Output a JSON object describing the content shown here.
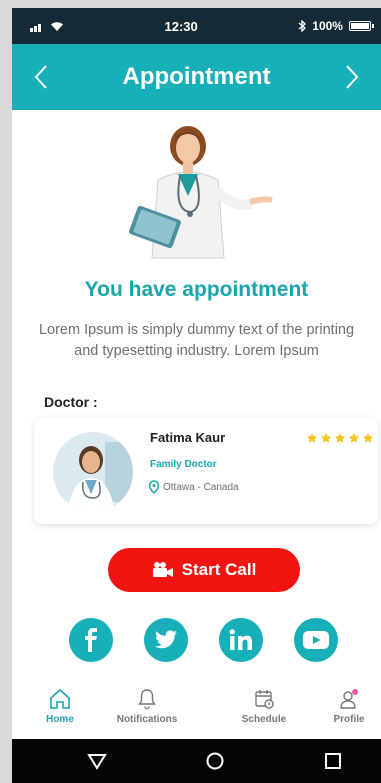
{
  "status": {
    "time": "12:30",
    "battery": "100%"
  },
  "appbar": {
    "title": "Appointment"
  },
  "main": {
    "headline": "You have appointment",
    "description": "Lorem Ipsum is simply dummy text of the printing and typesetting industry. Lorem Ipsum",
    "section_label": "Doctor :"
  },
  "doctor": {
    "name": "Fatima Kaur",
    "role": "Family Doctor",
    "location": "Ottawa - Canada",
    "rating": 5
  },
  "call_button": {
    "label": "Start Call"
  },
  "social": [
    "facebook-icon",
    "twitter-icon",
    "linkedin-icon",
    "youtube-icon"
  ],
  "tabs": [
    {
      "label": "Home",
      "active": true
    },
    {
      "label": "Notifications",
      "active": false
    },
    {
      "label": "Schedule",
      "active": false
    },
    {
      "label": "Profile",
      "active": false
    }
  ],
  "colors": {
    "primary": "#17b0b8",
    "accent": "#f21411",
    "statusbar": "#142a36"
  }
}
